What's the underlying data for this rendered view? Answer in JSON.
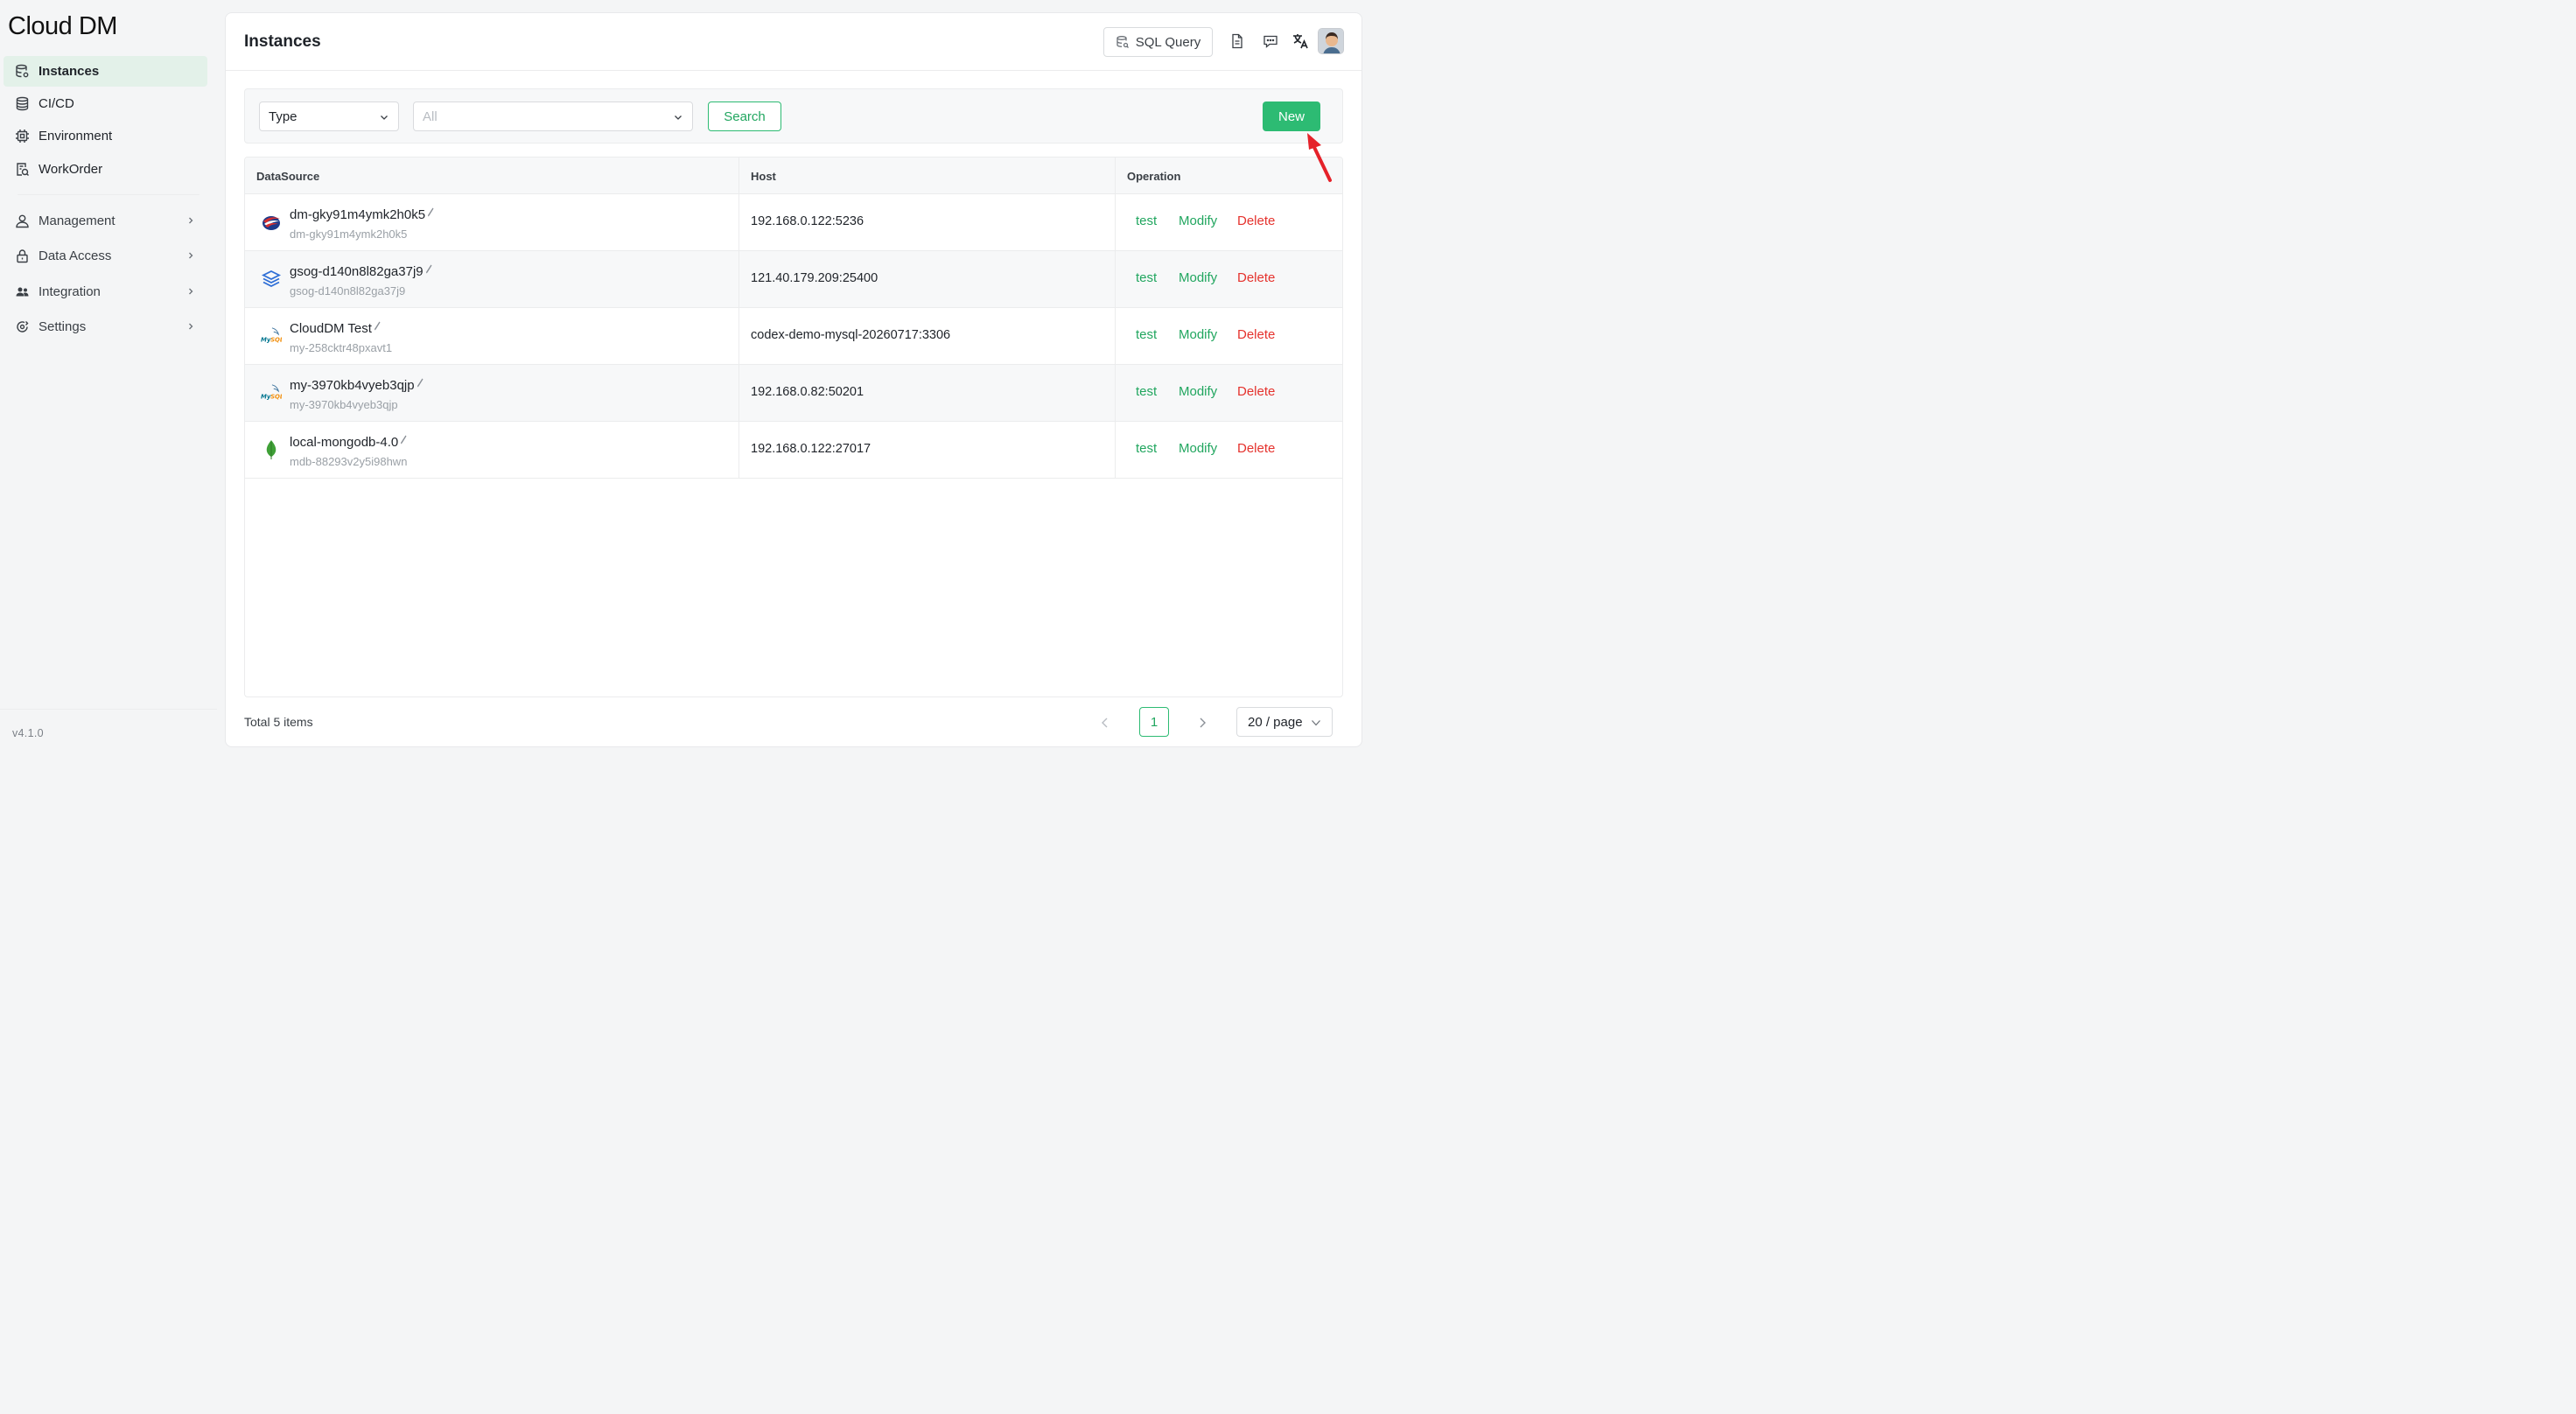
{
  "app": {
    "logo_text": "Cloud DM",
    "version": "v4.1.0"
  },
  "sidebar": {
    "primary": [
      {
        "label": "Instances",
        "icon": "database-icon",
        "active": true
      },
      {
        "label": "CI/CD",
        "icon": "database-stack-icon"
      },
      {
        "label": "Environment",
        "icon": "chip-icon"
      },
      {
        "label": "WorkOrder",
        "icon": "work-order-icon"
      }
    ],
    "groups": [
      {
        "label": "Management",
        "icon": "user-icon"
      },
      {
        "label": "Data Access",
        "icon": "lock-icon"
      },
      {
        "label": "Integration",
        "icon": "team-icon"
      },
      {
        "label": "Settings",
        "icon": "settings-icon"
      }
    ]
  },
  "header": {
    "title": "Instances",
    "sql_query_label": "SQL Query",
    "icons": [
      "document-icon",
      "chat-icon",
      "translate-icon",
      "avatar"
    ]
  },
  "filters": {
    "type_label": "Type",
    "all_placeholder": "All",
    "search_label": "Search",
    "new_label": "New"
  },
  "table": {
    "columns": [
      "DataSource",
      "Host",
      "Operation"
    ],
    "rows": [
      {
        "name": "dm-gky91m4ymk2h0k5",
        "id": "dm-gky91m4ymk2h0k5",
        "host": "192.168.0.122:5236",
        "icon": "dameng-icon"
      },
      {
        "name": "gsog-d140n8l82ga37j9",
        "id": "gsog-d140n8l82ga37j9",
        "host": "121.40.179.209:25400",
        "icon": "gaussdb-icon"
      },
      {
        "name": "CloudDM Test",
        "id": "my-258cktr48pxavt1",
        "host": "codex-demo-mysql-20260717:3306",
        "icon": "mysql-icon"
      },
      {
        "name": "my-3970kb4vyeb3qjp",
        "id": "my-3970kb4vyeb3qjp",
        "host": "192.168.0.82:50201",
        "icon": "mysql-icon"
      },
      {
        "name": "local-mongodb-4.0",
        "id": "mdb-88293v2y5i98hwn",
        "host": "192.168.0.122:27017",
        "icon": "mongodb-leaf-icon"
      }
    ],
    "actions": {
      "test": "test",
      "modify": "Modify",
      "delete": "Delete"
    }
  },
  "footer": {
    "total": "Total 5 items",
    "current_page": "1",
    "page_size": "20 / page"
  },
  "colors": {
    "accent": "#2dbb73",
    "danger": "#e5322d",
    "active_bg": "#e3f1e9"
  }
}
